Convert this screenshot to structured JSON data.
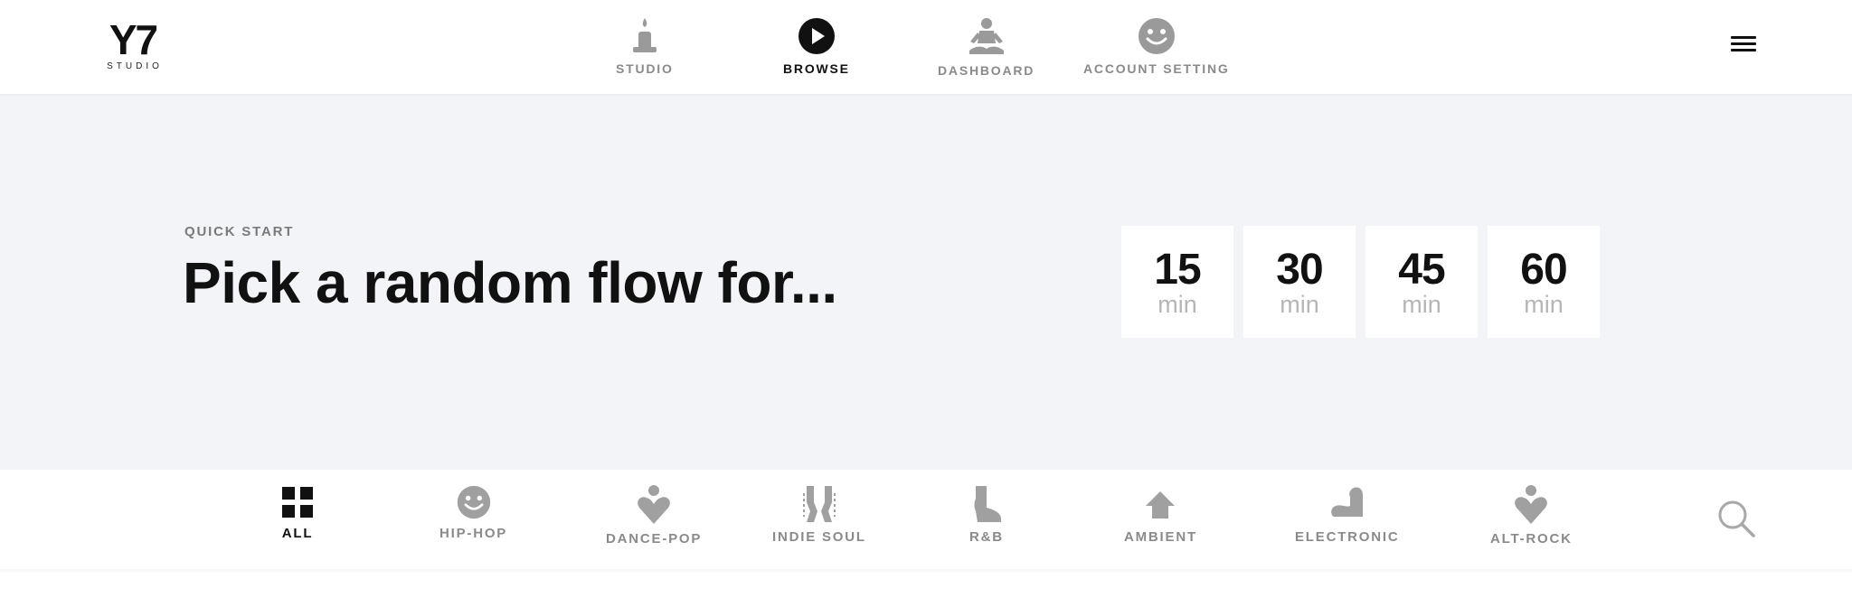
{
  "brand": {
    "mark": "Y7",
    "sub": "STUDIO"
  },
  "nav": {
    "items": [
      {
        "label": "STUDIO",
        "icon": "candle-icon",
        "active": false
      },
      {
        "label": "BROWSE",
        "icon": "play-icon",
        "active": true
      },
      {
        "label": "DASHBOARD",
        "icon": "meditation-icon",
        "active": false
      },
      {
        "label": "ACCOUNT SETTING",
        "icon": "smiley-icon",
        "active": false
      }
    ],
    "menu_icon": "hamburger-menu-icon"
  },
  "hero": {
    "eyebrow": "QUICK START",
    "headline": "Pick a random flow for...",
    "durations": [
      {
        "value": "15",
        "unit": "min"
      },
      {
        "value": "30",
        "unit": "min"
      },
      {
        "value": "45",
        "unit": "min"
      },
      {
        "value": "60",
        "unit": "min"
      }
    ]
  },
  "genres": {
    "items": [
      {
        "label": "ALL",
        "icon": "grid-icon",
        "active": true
      },
      {
        "label": "HIP-HOP",
        "icon": "smiley-icon",
        "active": false
      },
      {
        "label": "DANCE-POP",
        "icon": "heart-figure-icon",
        "active": false
      },
      {
        "label": "INDIE SOUL",
        "icon": "body-icon",
        "active": false
      },
      {
        "label": "R&B",
        "icon": "boot-icon",
        "active": false
      },
      {
        "label": "AMBIENT",
        "icon": "house-icon",
        "active": false
      },
      {
        "label": "ELECTRONIC",
        "icon": "flex-arm-icon",
        "active": false
      },
      {
        "label": "ALT-ROCK",
        "icon": "heart-figure-icon",
        "active": false
      }
    ],
    "search_icon": "search-icon"
  },
  "colors": {
    "active": "#111111",
    "inactive": "#8a8a8a",
    "hero_bg": "#f3f4f7",
    "icon_gray": "#a0a0a0"
  }
}
